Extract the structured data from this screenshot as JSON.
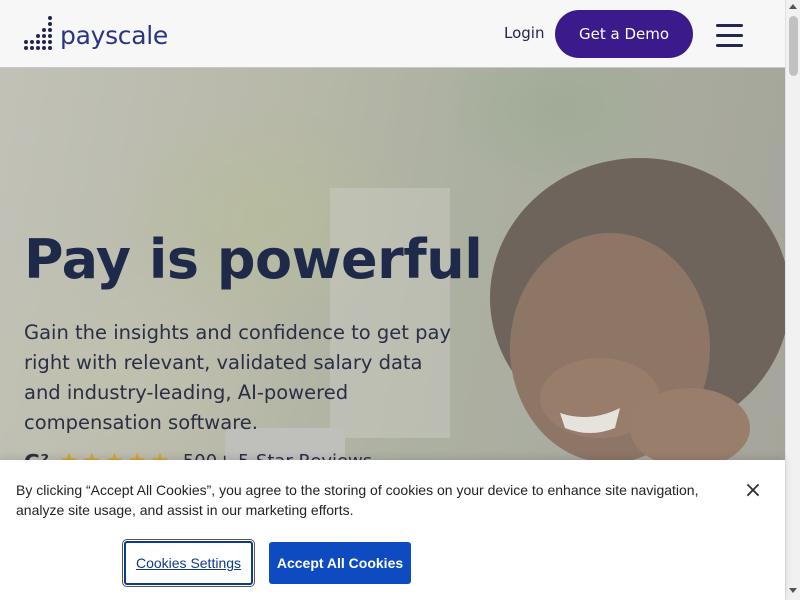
{
  "header": {
    "logo_text": "payscale",
    "login_label": "Login",
    "demo_label": "Get a Demo",
    "menu_icon": "hamburger-menu-icon"
  },
  "hero": {
    "title": "Pay is powerful",
    "subtitle": "Gain the insights and confidence to get pay right with relevant, validated salary data and industry-leading, AI-powered compensation software.",
    "rating_icon": "g2-icon",
    "rating_stars": "★★★★★",
    "rating_text": "500+ 5-Star Reviews"
  },
  "cookie_banner": {
    "message": "By clicking “Accept All Cookies”, you agree to the storing of cookies on your device to enhance site navigation, analyze site usage, and assist in our marketing efforts.",
    "settings_label": "Cookies Settings",
    "accept_label": "Accept All Cookies",
    "close_label": "×"
  },
  "colors": {
    "brand_purple": "#3b1a8c",
    "logo_navy": "#2c3580",
    "accept_blue": "#0f4bc0"
  }
}
